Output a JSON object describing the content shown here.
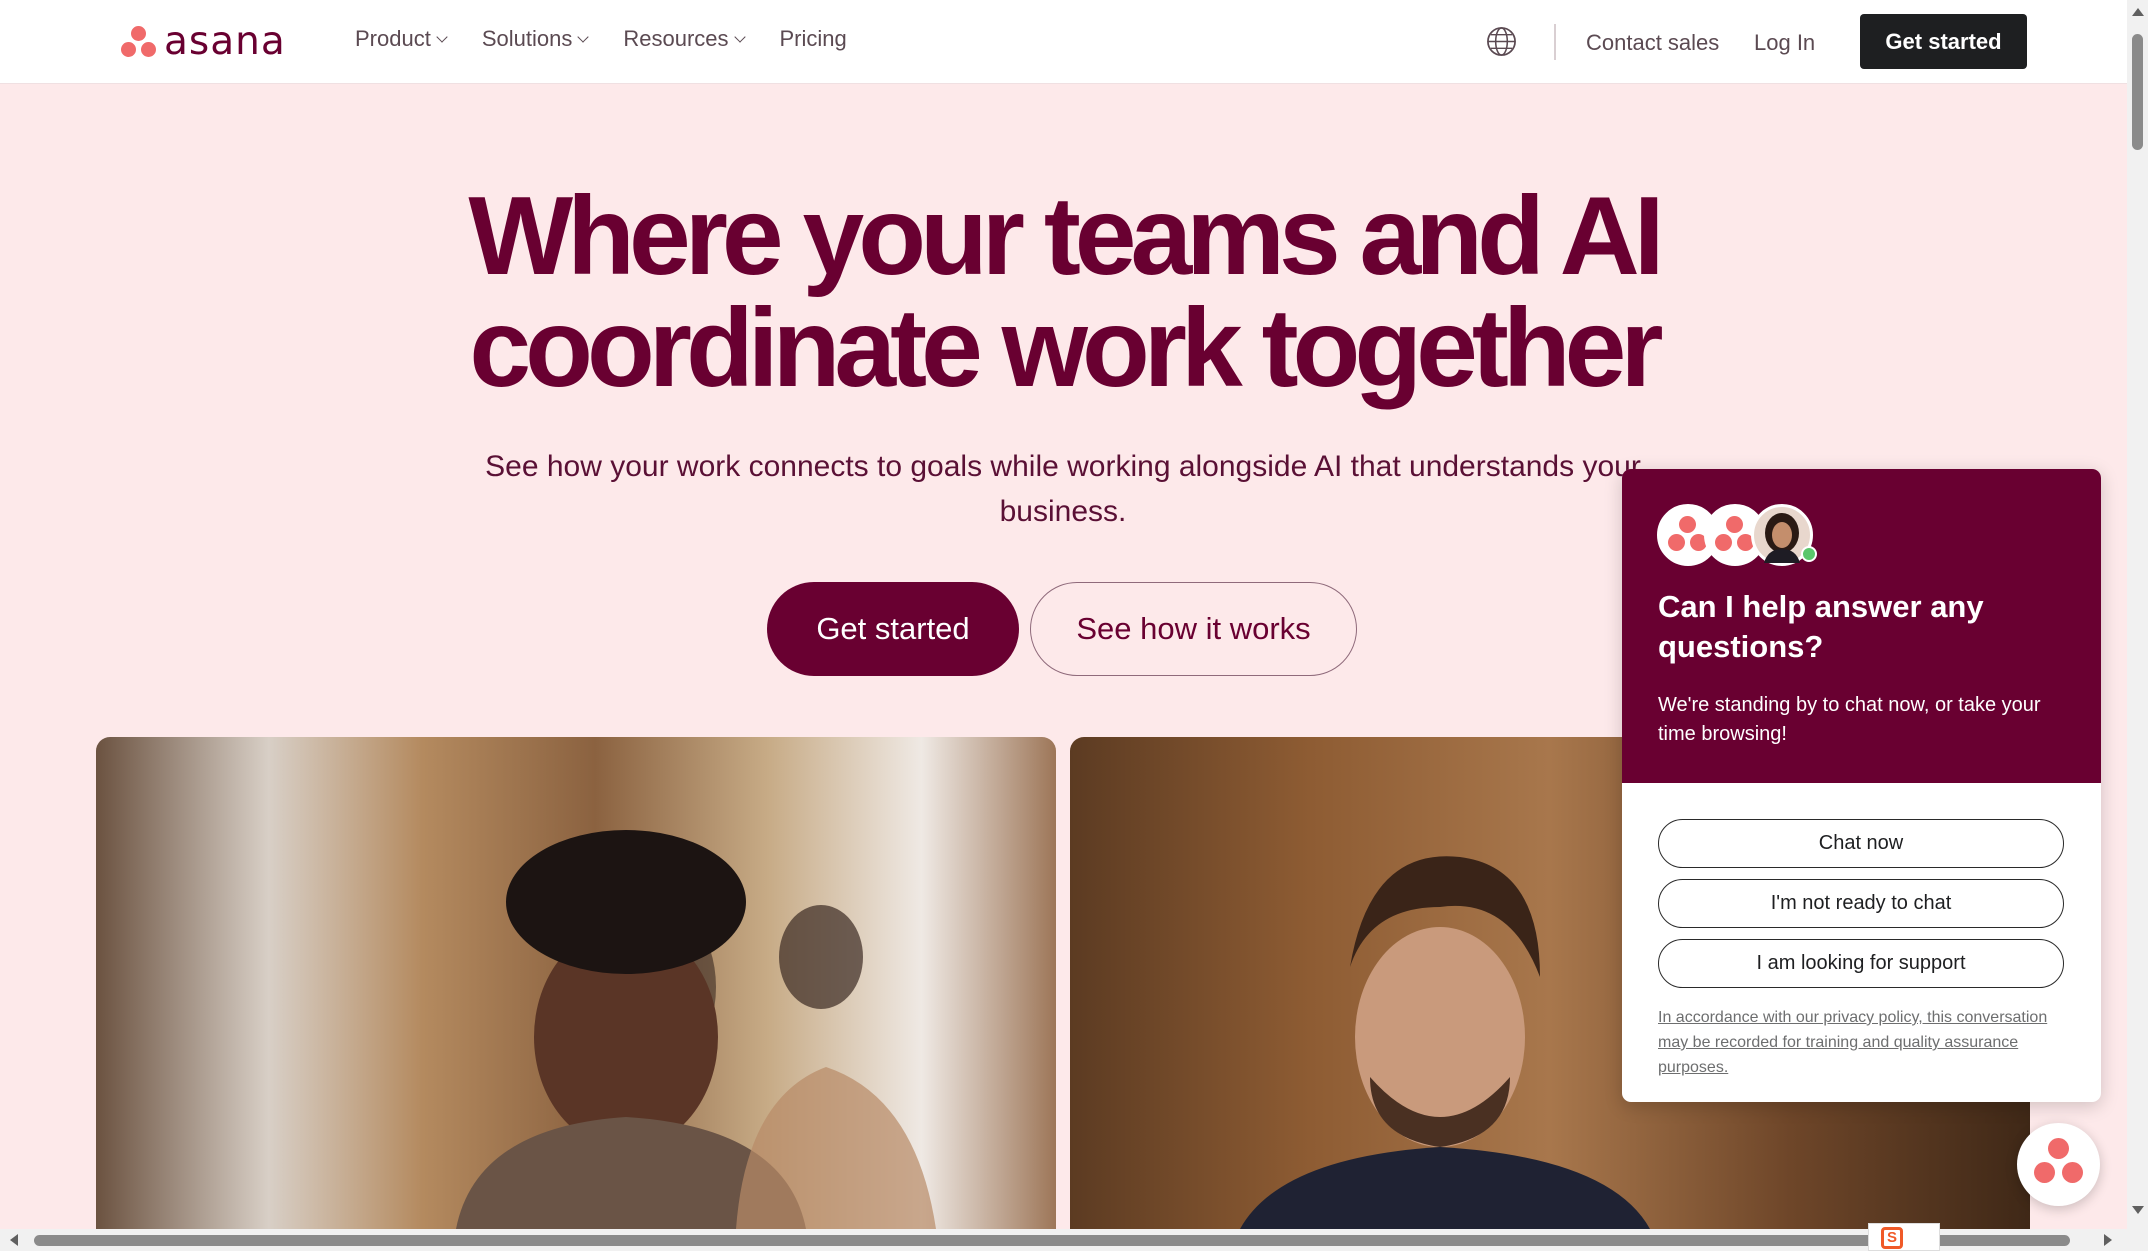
{
  "nav": {
    "brand": "asana",
    "links": [
      {
        "label": "Product",
        "has_dropdown": true
      },
      {
        "label": "Solutions",
        "has_dropdown": true
      },
      {
        "label": "Resources",
        "has_dropdown": true
      },
      {
        "label": "Pricing",
        "has_dropdown": false
      }
    ],
    "language_icon": "globe-icon",
    "contact_sales": "Contact sales",
    "login": "Log In",
    "cta": "Get started"
  },
  "hero": {
    "title_line1": "Where your teams and AI",
    "title_line2": "coordinate work together",
    "subtitle": "See how your work connects to goals while working alongside AI that understands your business.",
    "primary_button": "Get started",
    "secondary_button": "See how it works"
  },
  "photos": [
    {
      "alt": "woman working on laptop in office"
    },
    {
      "alt": "man working on laptop"
    }
  ],
  "chat": {
    "title": "Can I help answer any questions?",
    "description": "We're standing by to chat now, or take your time browsing!",
    "options": [
      "Chat now",
      "I'm not ready to chat",
      "I am looking for support"
    ],
    "legal": "In accordance with our privacy policy, this conversation may be recorded for training and quality assurance purposes.",
    "launcher_icon": "asana-logo-icon"
  },
  "colors": {
    "brand": "#690031",
    "page_background": "#fde9ea",
    "logo_coral": "#f06a6a",
    "nav_cta": "#1e1f21"
  }
}
